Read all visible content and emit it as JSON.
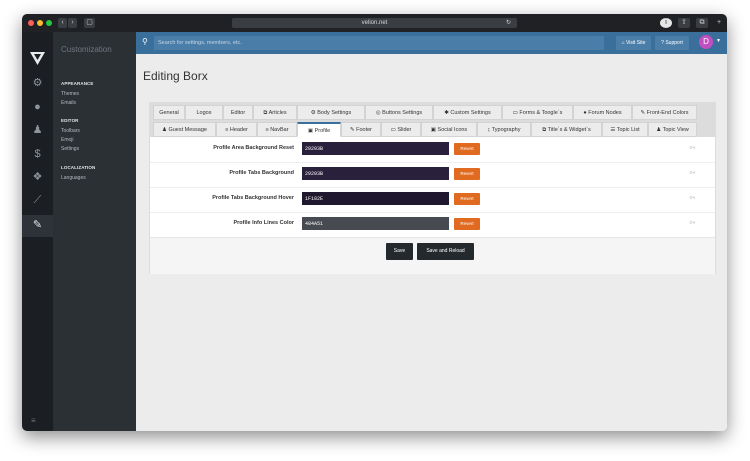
{
  "browser": {
    "url": "velion.net"
  },
  "colors": {
    "close": "#fe5f57",
    "minimize": "#febc2e",
    "maximize": "#28c840",
    "accent": "#3a6e9b",
    "revert": "#e06a1f"
  },
  "nav": {
    "title": "Customization",
    "sections": [
      {
        "label": "APPEARANCE",
        "items": [
          "Themes",
          "Emails"
        ]
      },
      {
        "label": "EDITOR",
        "items": [
          "Toolbars",
          "Emoji",
          "Settings"
        ]
      },
      {
        "label": "LOCALIZATION",
        "items": [
          "Languages"
        ]
      }
    ]
  },
  "header": {
    "search_placeholder": "Search for settings, members, etc.",
    "visit_site": "Visit Site",
    "support": "Support",
    "avatar_letter": "D"
  },
  "page": {
    "title": "Editing Borx"
  },
  "tabs_row1": [
    "General",
    "Logos",
    "Editor",
    "Articles",
    "Body Settings",
    "Buttons Settings",
    "Custom Settings",
    "Forms & Toogle`s",
    "Forum Nodes",
    "Front-End Colors"
  ],
  "tabs_row2": [
    "Guest Message",
    "Header",
    "NavBar",
    "Profile",
    "Footer",
    "Slider",
    "Social Icons",
    "Typography",
    "Title`s & Widget`s",
    "Topic List",
    "Topic View"
  ],
  "active_tab": "Profile",
  "settings": [
    {
      "label": "Profile Area Background Reset",
      "value": "29203B",
      "color": "#29203b",
      "revert": "Revert"
    },
    {
      "label": "Profile Tabs Background",
      "value": "29203B",
      "color": "#29203b",
      "revert": "Revert"
    },
    {
      "label": "Profile Tabs Background Hover",
      "value": "1F182E",
      "color": "#1f182e",
      "revert": "Revert"
    },
    {
      "label": "Profile Info Lines Color",
      "value": "484A51",
      "color": "#484a51",
      "revert": "Revert"
    }
  ],
  "actions": {
    "save": "Save",
    "save_reload": "Save and Reload"
  }
}
